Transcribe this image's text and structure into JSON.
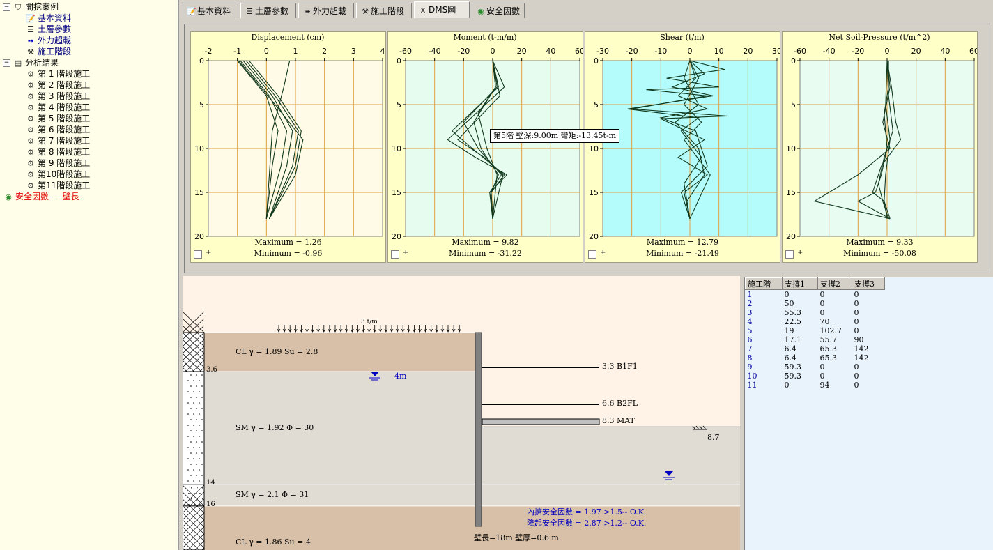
{
  "tree": [
    {
      "label": "開挖案例",
      "indent": 0,
      "icon": "root-tree-icon",
      "expander": "−",
      "color": "#000000"
    },
    {
      "label": "基本資料",
      "indent": 1,
      "icon": "notepad-icon",
      "color": "#000080"
    },
    {
      "label": "土層參數",
      "indent": 1,
      "icon": "soil-layers-icon",
      "color": "#000080"
    },
    {
      "label": "外力超載",
      "indent": 1,
      "icon": "load-arrow-icon",
      "color": "#000080"
    },
    {
      "label": "施工階段",
      "indent": 1,
      "icon": "excavator-icon",
      "color": "#000080"
    },
    {
      "label": "分析結果",
      "indent": 0,
      "icon": "book-icon",
      "expander": "−",
      "color": "#000000"
    },
    {
      "label": "第 1 階段施工",
      "indent": 1,
      "icon": "stage-tool-icon",
      "color": "#000000"
    },
    {
      "label": "第 2 階段施工",
      "indent": 1,
      "icon": "stage-tool-icon",
      "color": "#000000"
    },
    {
      "label": "第 3 階段施工",
      "indent": 1,
      "icon": "stage-tool-icon",
      "color": "#000000"
    },
    {
      "label": "第 4 階段施工",
      "indent": 1,
      "icon": "stage-tool-icon",
      "color": "#000000"
    },
    {
      "label": "第 5 階段施工",
      "indent": 1,
      "icon": "stage-tool-icon",
      "color": "#000000"
    },
    {
      "label": "第 6 階段施工",
      "indent": 1,
      "icon": "stage-tool-icon",
      "color": "#000000"
    },
    {
      "label": "第 7 階段施工",
      "indent": 1,
      "icon": "stage-tool-icon",
      "color": "#000000"
    },
    {
      "label": "第 8 階段施工",
      "indent": 1,
      "icon": "stage-tool-icon",
      "color": "#000000"
    },
    {
      "label": "第 9 階段施工",
      "indent": 1,
      "icon": "stage-tool-icon",
      "color": "#000000"
    },
    {
      "label": "第10階段施工",
      "indent": 1,
      "icon": "stage-tool-icon",
      "color": "#000000"
    },
    {
      "label": "第11階段施工",
      "indent": 1,
      "icon": "stage-tool-icon",
      "color": "#000000"
    },
    {
      "label": "安全因數 — 壁長",
      "indent": 0,
      "icon": "globe-icon",
      "color": "#e00000"
    }
  ],
  "tabs": [
    {
      "label": "基本資料",
      "icon": "notepad-icon",
      "active": false
    },
    {
      "label": "土層參數",
      "icon": "soil-layers-icon",
      "active": false
    },
    {
      "label": "外力超載",
      "icon": "load-arrow-icon",
      "active": false
    },
    {
      "label": "施工階段",
      "icon": "excavator-icon",
      "active": false
    },
    {
      "label": "DMS圖",
      "icon": "dms-chart-icon",
      "active": true
    },
    {
      "label": "安全因數",
      "icon": "globe-icon",
      "active": false
    }
  ],
  "colors": {
    "grid": "#e0a040",
    "curve": "#10381c",
    "panel_bg": "#ffffc8",
    "plot_displacement": "#fffbe6",
    "plot_moment": "#e6fcef",
    "plot_shear": "#b4fcfc",
    "plot_pressure": "#e8fcf2",
    "clay": "#d8c0a8",
    "sand": "#e0dcd4",
    "wall": "#808080",
    "water": "#0000c0",
    "fs_text": "#0000c0"
  },
  "charts": [
    {
      "title": "Displacement (cm)",
      "xlim": [
        -2,
        4
      ],
      "xticks": [
        "-2",
        "-1",
        "0",
        "1",
        "2",
        "3",
        "4"
      ],
      "ylim": [
        0,
        20
      ],
      "yticks": [
        "0",
        "5",
        "10",
        "15",
        "20"
      ],
      "max": "Maximum = 1.26",
      "min": "Minimum = -0.96",
      "plot_color": "#fffbe6",
      "series": [
        [
          [
            -1.0,
            0
          ],
          [
            0.0,
            4
          ],
          [
            0.4,
            8
          ],
          [
            0.2,
            12
          ],
          [
            0.0,
            18
          ]
        ],
        [
          [
            -0.9,
            0
          ],
          [
            0.1,
            4
          ],
          [
            0.7,
            8
          ],
          [
            0.5,
            12
          ],
          [
            0.0,
            18
          ]
        ],
        [
          [
            -0.8,
            0
          ],
          [
            0.2,
            4
          ],
          [
            0.9,
            8
          ],
          [
            0.7,
            12
          ],
          [
            0.1,
            18
          ]
        ],
        [
          [
            -0.7,
            0
          ],
          [
            0.3,
            4
          ],
          [
            1.1,
            8
          ],
          [
            0.9,
            12
          ],
          [
            0.1,
            18
          ]
        ],
        [
          [
            -0.6,
            0
          ],
          [
            0.4,
            4
          ],
          [
            1.2,
            8
          ],
          [
            1.0,
            12
          ],
          [
            0.1,
            18
          ]
        ],
        [
          [
            -0.96,
            0
          ],
          [
            0.3,
            5
          ],
          [
            1.26,
            9
          ],
          [
            1.0,
            13
          ],
          [
            0.1,
            18
          ]
        ],
        [
          [
            0.8,
            0
          ],
          [
            0.6,
            3
          ],
          [
            0.2,
            8
          ],
          [
            0.0,
            18
          ]
        ]
      ]
    },
    {
      "title": "Moment (t-m/m)",
      "xlim": [
        -60,
        60
      ],
      "xticks": [
        "-60",
        "-40",
        "-20",
        "0",
        "20",
        "40",
        "60"
      ],
      "ylim": [
        0,
        20
      ],
      "yticks": [
        "0",
        "5",
        "10",
        "15",
        "20"
      ],
      "max": "Maximum = 9.82",
      "min": "Minimum = -31.22",
      "plot_color": "#e6fcef",
      "series": [
        [
          [
            0,
            0
          ],
          [
            2,
            3
          ],
          [
            -13,
            7
          ],
          [
            -8,
            10
          ],
          [
            4,
            13
          ],
          [
            -1,
            15
          ],
          [
            0,
            18
          ]
        ],
        [
          [
            0,
            0
          ],
          [
            3,
            3
          ],
          [
            -20,
            7
          ],
          [
            -10,
            10
          ],
          [
            6,
            13
          ],
          [
            -2,
            15
          ],
          [
            0,
            18
          ]
        ],
        [
          [
            0,
            0
          ],
          [
            4,
            3
          ],
          [
            -28,
            8
          ],
          [
            -14,
            10
          ],
          [
            8,
            13
          ],
          [
            -1,
            15
          ],
          [
            0,
            18
          ]
        ],
        [
          [
            0,
            0
          ],
          [
            8,
            3
          ],
          [
            -31,
            9
          ],
          [
            -12,
            11
          ],
          [
            9.8,
            13
          ],
          [
            -2,
            15
          ],
          [
            0,
            18
          ]
        ],
        [
          [
            0,
            0
          ],
          [
            5,
            4
          ],
          [
            -24,
            9
          ],
          [
            -6,
            11
          ],
          [
            7,
            13
          ],
          [
            0,
            18
          ]
        ],
        [
          [
            0,
            0
          ],
          [
            2,
            3
          ],
          [
            -10,
            6
          ],
          [
            -4,
            10
          ],
          [
            3,
            13
          ],
          [
            0,
            18
          ]
        ]
      ]
    },
    {
      "title": "Shear (t/m)",
      "xlim": [
        -30,
        30
      ],
      "xticks": [
        "-30",
        "-20",
        "-10",
        "0",
        "10",
        "20",
        "30"
      ],
      "ylim": [
        0,
        20
      ],
      "yticks": [
        "0",
        "5",
        "10",
        "15",
        "20"
      ],
      "max": "Maximum = 12.79",
      "min": "Minimum = -21.49",
      "plot_color": "#b4fcfc",
      "series": [
        [
          [
            0,
            0
          ],
          [
            12,
            1
          ],
          [
            -8,
            2
          ],
          [
            10,
            3
          ],
          [
            -15,
            3.3
          ],
          [
            6,
            4
          ],
          [
            -20,
            5.5
          ],
          [
            12.79,
            6.3
          ],
          [
            -10,
            6.6
          ],
          [
            5,
            9
          ],
          [
            -4,
            11
          ],
          [
            6,
            13
          ],
          [
            -2,
            15
          ],
          [
            0,
            18
          ]
        ],
        [
          [
            0,
            0
          ],
          [
            5,
            1.5
          ],
          [
            -6,
            3
          ],
          [
            8,
            4
          ],
          [
            -21.49,
            5.5
          ],
          [
            3,
            6.5
          ],
          [
            -3,
            8
          ],
          [
            4,
            11
          ],
          [
            -2,
            14
          ],
          [
            0,
            18
          ]
        ],
        [
          [
            0,
            0
          ],
          [
            2,
            2
          ],
          [
            -4,
            4
          ],
          [
            6,
            5.5
          ],
          [
            -10,
            6.5
          ],
          [
            2,
            8
          ],
          [
            6,
            12
          ],
          [
            -3,
            15
          ],
          [
            0,
            18
          ]
        ],
        [
          [
            0,
            0
          ],
          [
            3,
            2
          ],
          [
            -2,
            5
          ],
          [
            4,
            7
          ],
          [
            -2,
            9
          ],
          [
            7,
            13
          ],
          [
            0,
            18
          ]
        ],
        [
          [
            0,
            0
          ],
          [
            -2,
            2
          ],
          [
            3,
            5
          ],
          [
            -5,
            7
          ],
          [
            3,
            10
          ],
          [
            5,
            13
          ],
          [
            -1,
            16
          ],
          [
            0,
            18
          ]
        ]
      ]
    },
    {
      "title": "Net Soil-Pressure (t/m^2)",
      "xlim": [
        -60,
        60
      ],
      "xticks": [
        "-60",
        "-40",
        "-20",
        "0",
        "20",
        "40",
        "60"
      ],
      "ylim": [
        0,
        20
      ],
      "yticks": [
        "0",
        "5",
        "10",
        "15",
        "20"
      ],
      "max": "Maximum = 9.33",
      "min": "Minimum = -50.08",
      "plot_color": "#e8fcf2",
      "series": [
        [
          [
            1,
            0
          ],
          [
            1,
            3
          ],
          [
            -2,
            6
          ],
          [
            0,
            10
          ],
          [
            -4,
            13
          ],
          [
            -8,
            15
          ],
          [
            -20,
            16
          ],
          [
            2,
            18
          ]
        ],
        [
          [
            0,
            0
          ],
          [
            2,
            3
          ],
          [
            -3,
            7
          ],
          [
            2,
            10
          ],
          [
            -20,
            13
          ],
          [
            -50.08,
            16
          ],
          [
            -24,
            17
          ],
          [
            2,
            18
          ]
        ],
        [
          [
            0,
            0
          ],
          [
            3,
            3
          ],
          [
            6,
            7
          ],
          [
            9.33,
            9
          ],
          [
            -4,
            12
          ],
          [
            -10,
            15
          ],
          [
            -2,
            16
          ],
          [
            2,
            18
          ]
        ],
        [
          [
            0,
            0
          ],
          [
            1,
            4
          ],
          [
            4,
            8
          ],
          [
            -2,
            11
          ],
          [
            -6,
            14
          ],
          [
            -3,
            16
          ],
          [
            1,
            18
          ]
        ],
        [
          [
            0,
            0
          ],
          [
            -1,
            5
          ],
          [
            2,
            9
          ],
          [
            -1,
            13
          ],
          [
            -2,
            16
          ],
          [
            0,
            18
          ]
        ]
      ]
    }
  ],
  "tooltip": "第5階 壁深:9.00m 彎矩:-13.45t-m",
  "section": {
    "surcharge": "3 t/m",
    "layers": [
      {
        "label": "CL γ = 1.89   Su = 2.8",
        "top": 0,
        "bottom": 3.6,
        "type": "clay"
      },
      {
        "label": "SM γ = 1.92   Φ = 30",
        "top": 3.6,
        "bottom": 14,
        "type": "sand"
      },
      {
        "label": "SM γ = 2.1   Φ = 31",
        "top": 14,
        "bottom": 16,
        "type": "sand"
      },
      {
        "label": "CL γ = 1.86   Su = 4",
        "top": 16,
        "bottom": 20,
        "type": "clay"
      }
    ],
    "depth_labels": [
      "3.6",
      "14",
      "16"
    ],
    "water_level": "4m",
    "struts": [
      {
        "label": "3.3  B1F1",
        "depth": 3.3,
        "slab": false
      },
      {
        "label": "6.6  B2FL",
        "depth": 6.6,
        "slab": false
      },
      {
        "label": "8.3  MAT",
        "depth": 8.3,
        "slab": true
      }
    ],
    "excavation_depth": "8.7",
    "fs_heave": "內擠安全因數 = 1.97 >1.5-- O.K.",
    "fs_uplift": "隆起安全因數 = 2.87 >1.2-- O.K.",
    "wall_info": "壁長=18m  壁厚=0.6 m"
  },
  "strut_table": {
    "headers": [
      "施工階",
      "支撐1",
      "支撐2",
      "支撐3"
    ],
    "rows": [
      [
        "1",
        "0",
        "0",
        "0"
      ],
      [
        "2",
        "50",
        "0",
        "0"
      ],
      [
        "3",
        "55.3",
        "0",
        "0"
      ],
      [
        "4",
        "22.5",
        "70",
        "0"
      ],
      [
        "5",
        "19",
        "102.7",
        "0"
      ],
      [
        "6",
        "17.1",
        "55.7",
        "90"
      ],
      [
        "7",
        "6.4",
        "65.3",
        "142"
      ],
      [
        "8",
        "6.4",
        "65.3",
        "142"
      ],
      [
        "9",
        "59.3",
        "0",
        "0"
      ],
      [
        "10",
        "59.3",
        "0",
        "0"
      ],
      [
        "11",
        "0",
        "94",
        "0"
      ]
    ]
  }
}
